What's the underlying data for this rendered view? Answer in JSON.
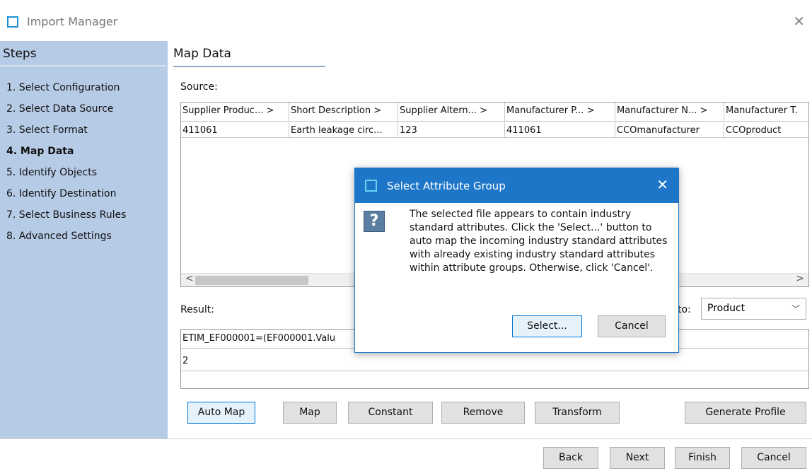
{
  "window": {
    "title": "Import Manager",
    "close_glyph": "✕"
  },
  "steps": {
    "title": "Steps",
    "items": [
      "1. Select Configuration",
      "2. Select Data Source",
      "3. Select Format",
      "4. Map Data",
      "5. Identify Objects",
      "6. Identify Destination",
      "7. Select Business Rules",
      "8. Advanced Settings"
    ],
    "current_index": 3
  },
  "main": {
    "title": "Map Data",
    "source_label": "Source:",
    "result_label": "Result:",
    "target_label": "to:"
  },
  "source": {
    "columns": [
      "Supplier Produc... >",
      "Short Description >",
      "Supplier Altern... >",
      "Manufacturer P... >",
      "Manufacturer N... >",
      "Manufacturer T."
    ],
    "row": [
      "411061",
      "Earth leakage circ...",
      "123",
      "411061",
      "CCOmanufacturer",
      "CCOproduct"
    ]
  },
  "target_select": {
    "value": "Product",
    "icon": "chevron-down-icon"
  },
  "result": {
    "line1": "ETIM_EF000001=(EF000001.Valu",
    "line2": "2"
  },
  "toolbar": {
    "auto_map": "Auto Map",
    "map": "Map",
    "constant": "Constant",
    "remove": "Remove",
    "transform": "Transform",
    "generate_profile": "Generate Profile"
  },
  "footer": {
    "back": "Back",
    "next": "Next",
    "finish": "Finish",
    "cancel": "Cancel"
  },
  "dialog": {
    "title": "Select Attribute Group",
    "close_glyph": "✕",
    "icon": "question-icon",
    "message": "The selected file appears to contain industry standard attributes. Click the 'Select...' button to auto map the incoming industry standard attributes with already existing industry standard attributes within attribute groups. Otherwise, click 'Cancel'.",
    "select_label": "Select...",
    "cancel_label": "Cancel"
  },
  "colors": {
    "steps_bg": "#b6cbe6",
    "dialog_title_bg": "#1e76c9",
    "focus_border": "#0078d7"
  }
}
